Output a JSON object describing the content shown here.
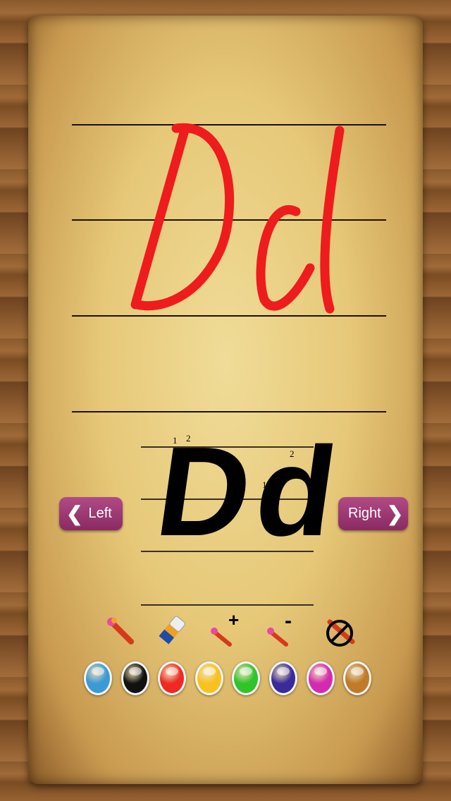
{
  "letter_guide": {
    "text": "Dd",
    "stroke_numbers": [
      "1",
      "2",
      "1",
      "2"
    ]
  },
  "nav": {
    "left_label": "Left",
    "right_label": "Right",
    "left_icon": "chevron-left-icon",
    "right_icon": "chevron-right-icon"
  },
  "drawing": {
    "stroke_color": "#ee1c1c"
  },
  "tools": [
    {
      "name": "brush-icon"
    },
    {
      "name": "eraser-icon"
    },
    {
      "name": "brush-size-increase-icon",
      "symbol": "+"
    },
    {
      "name": "brush-size-decrease-icon",
      "symbol": "-"
    },
    {
      "name": "clear-drawing-icon"
    }
  ],
  "palette": [
    "#3a9ad8",
    "#111111",
    "#ee2a22",
    "#f7c21e",
    "#2fc42a",
    "#3a2a9a",
    "#d42ab0",
    "#c07a28"
  ]
}
